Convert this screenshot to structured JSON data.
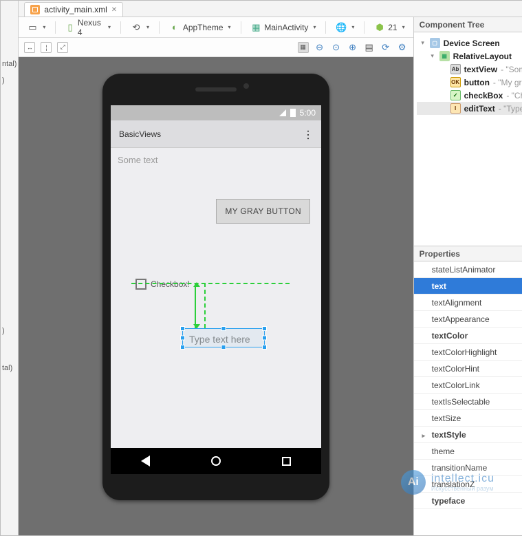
{
  "tab": {
    "title": "activity_main.xml"
  },
  "toolbar": {
    "device": "Nexus 4",
    "theme": "AppTheme",
    "activity": "MainActivity",
    "api": "21"
  },
  "statusbar": {
    "time": "5:00"
  },
  "app": {
    "title": "BasicViews",
    "text_view": "Some text",
    "button": "MY GRAY BUTTON",
    "checkbox": "Checkbox!",
    "edit_hint": "Type text here"
  },
  "componentTree": {
    "title": "Component Tree",
    "nodes": [
      {
        "name": "Device Screen",
        "desc": "",
        "icon": "device",
        "indent": 0
      },
      {
        "name": "RelativeLayout",
        "desc": "",
        "icon": "layout",
        "indent": 1
      },
      {
        "name": "textView",
        "desc": " - \"Some text\"",
        "icon": "text",
        "indent": 2
      },
      {
        "name": "button",
        "desc": " - \"My gray button\"",
        "icon": "button",
        "indent": 2
      },
      {
        "name": "checkBox",
        "desc": " - \"Checkbox! \"",
        "icon": "check",
        "indent": 2
      },
      {
        "name": "editText",
        "desc": " - \"Type text here\"",
        "icon": "edit",
        "indent": 2,
        "selected": true
      }
    ]
  },
  "properties": {
    "title": "Properties",
    "rows": [
      {
        "k": "stateListAnimator",
        "v": ""
      },
      {
        "k": "text",
        "v": "Type text here",
        "selected": true,
        "bold": true
      },
      {
        "k": "textAlignment",
        "v": ""
      },
      {
        "k": "textAppearance",
        "v": ""
      },
      {
        "k": "textColor",
        "v": "",
        "bold": true
      },
      {
        "k": "textColorHighlight",
        "v": ""
      },
      {
        "k": "textColorHint",
        "v": ""
      },
      {
        "k": "textColorLink",
        "v": ""
      },
      {
        "k": "textIsSelectable",
        "v": "",
        "checkbox": true
      },
      {
        "k": "textSize",
        "v": ""
      },
      {
        "k": "textStyle",
        "v": "[]",
        "bold": true,
        "expander": true
      },
      {
        "k": "theme",
        "v": ""
      },
      {
        "k": "transitionName",
        "v": ""
      },
      {
        "k": "translationZ",
        "v": ""
      },
      {
        "k": "typeface",
        "v": "",
        "bold": true
      }
    ]
  },
  "leftPeek": {
    "a": "ntal)",
    "b": ")",
    "c": ")",
    "d": "tal)"
  },
  "watermark": {
    "brand": "intellect.icu",
    "tagline": "Искусственный разум",
    "mark": "Ai"
  }
}
